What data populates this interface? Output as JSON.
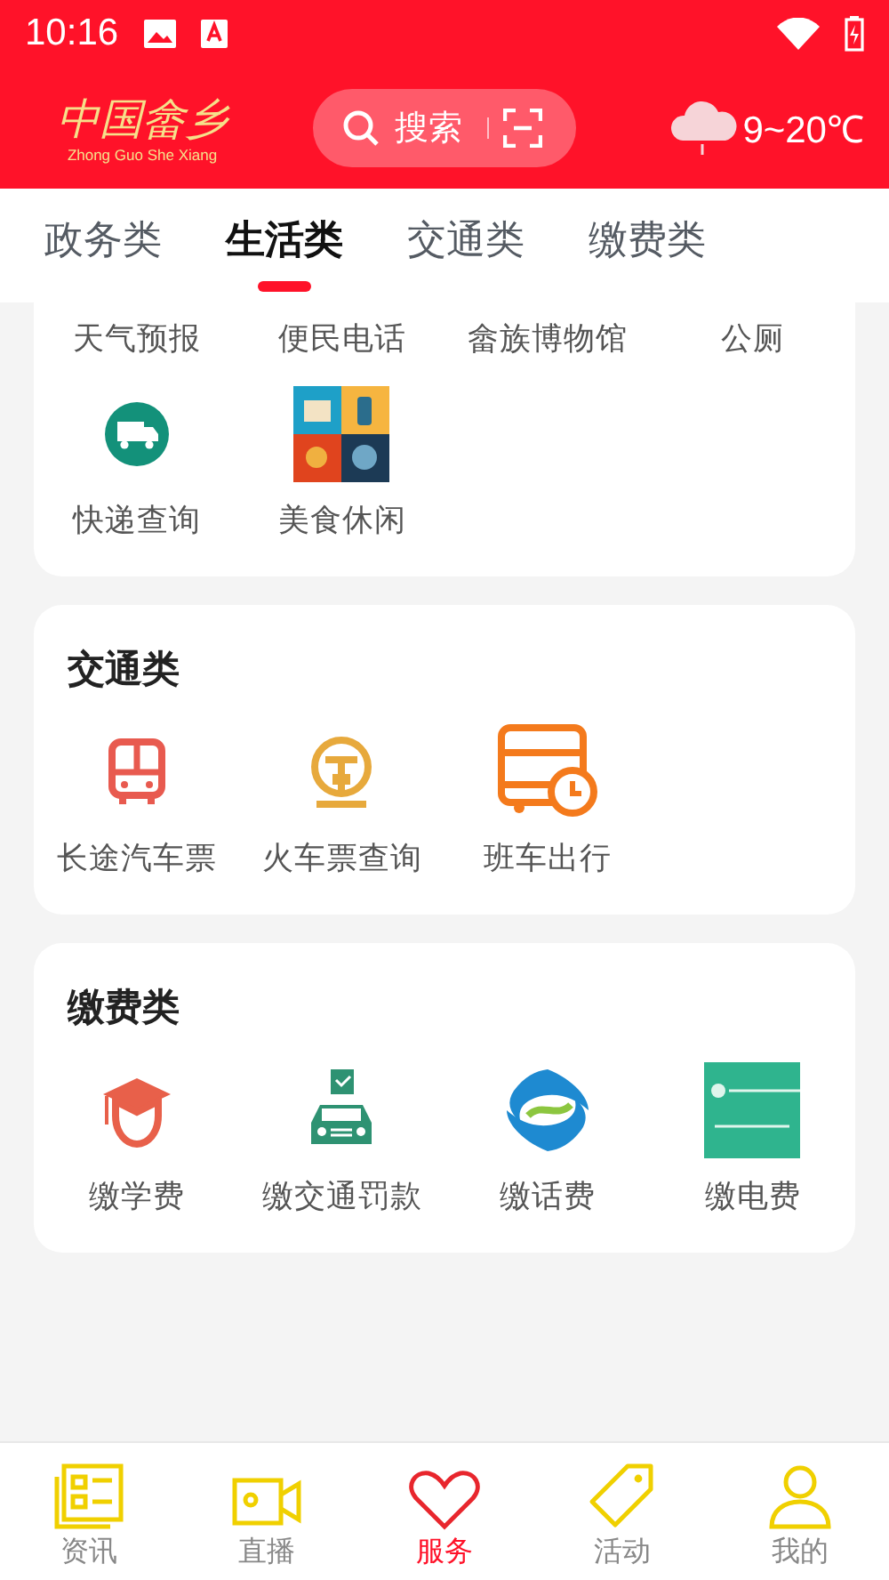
{
  "status_bar": {
    "time": "10:16"
  },
  "header": {
    "logo_title": "中国畲乡",
    "logo_subtitle": "Zhong Guo She Xiang",
    "search": {
      "placeholder": "搜索"
    },
    "weather": {
      "temperature": "9~20℃"
    }
  },
  "tabs": [
    {
      "label": "政务类",
      "selected": false
    },
    {
      "label": "生活类",
      "selected": true
    },
    {
      "label": "交通类",
      "selected": false
    },
    {
      "label": "缴费类",
      "selected": false
    }
  ],
  "sections": [
    {
      "items": [
        {
          "label": "天气预报"
        },
        {
          "label": "便民电话"
        },
        {
          "label": "畲族博物馆"
        },
        {
          "label": "公厕"
        },
        {
          "label": "快递查询",
          "kind": "truck"
        },
        {
          "label": "美食休闲",
          "kind": "food"
        }
      ]
    },
    {
      "title": "交通类",
      "items": [
        {
          "label": "长途汽车票",
          "kind": "bus"
        },
        {
          "label": "火车票查询",
          "kind": "train"
        },
        {
          "label": "班车出行",
          "kind": "shuttle"
        }
      ]
    },
    {
      "title": "缴费类",
      "items": [
        {
          "label": "缴学费",
          "kind": "grad"
        },
        {
          "label": "缴交通罚款",
          "kind": "car"
        },
        {
          "label": "缴话费",
          "kind": "mobile"
        },
        {
          "label": "缴电费",
          "kind": "power"
        }
      ]
    }
  ],
  "nav": [
    {
      "label": "资讯",
      "kind": "news",
      "selected": false
    },
    {
      "label": "直播",
      "kind": "video",
      "selected": false
    },
    {
      "label": "服务",
      "kind": "heart",
      "selected": true
    },
    {
      "label": "活动",
      "kind": "tag",
      "selected": false
    },
    {
      "label": "我的",
      "kind": "person",
      "selected": false
    }
  ]
}
